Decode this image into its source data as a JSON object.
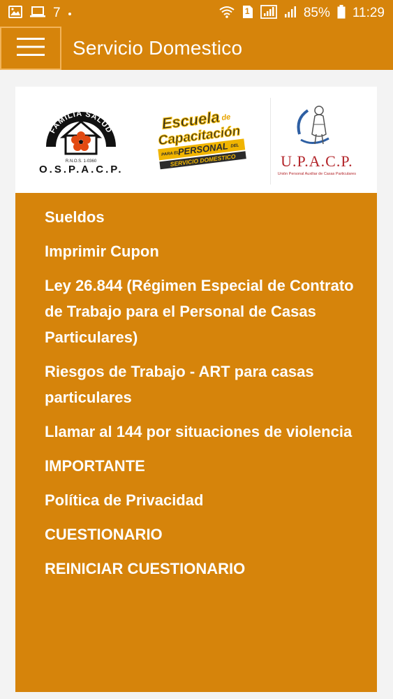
{
  "status_bar": {
    "left_text": "7",
    "battery": "85%",
    "time": "11:29",
    "sim_badge": "1",
    "icons": [
      "image-icon",
      "laptop-icon",
      "dot-icon",
      "wifi-icon",
      "sim-icon",
      "signal-icon",
      "signal-icon-2",
      "battery-icon"
    ]
  },
  "app_bar": {
    "title": "Servicio Domestico",
    "menu_icon": "hamburger-icon"
  },
  "logos": {
    "ospacp_arc": "FAMILIA SALUD",
    "ospacp_rnos": "R.N.O.S. 1-0360",
    "ospacp_name": "O.S.P.A.C.P.",
    "escuela_line1": "Escuela",
    "escuela_de": "de",
    "escuela_line2": "Capacitación",
    "escuela_para": "PARA EL",
    "escuela_line3": "PERSONAL",
    "escuela_del": "DEL",
    "escuela_line4": "SERVICIO DOMESTICO",
    "upacp_name": "U.P.A.C.P.",
    "upacp_sub": "Unión Personal Auxiliar de Casas Particulares"
  },
  "menu": {
    "items": [
      {
        "label": "Sueldos"
      },
      {
        "label": "Imprimir Cupon"
      },
      {
        "label": "Ley 26.844 (Régimen Especial de Contrato de Trabajo para el Personal de Casas Particulares)"
      },
      {
        "label": "Riesgos de Trabajo - ART para casas particulares"
      },
      {
        "label": "Llamar al 144 por situaciones de violencia"
      },
      {
        "label": "IMPORTANTE"
      },
      {
        "label": "Política de Privacidad"
      },
      {
        "label": "CUESTIONARIO"
      },
      {
        "label": "REINICIAR CUESTIONARIO"
      }
    ]
  },
  "colors": {
    "primary": "#d6840b",
    "background": "#f3f3f3",
    "upacp_red": "#b3262b"
  }
}
